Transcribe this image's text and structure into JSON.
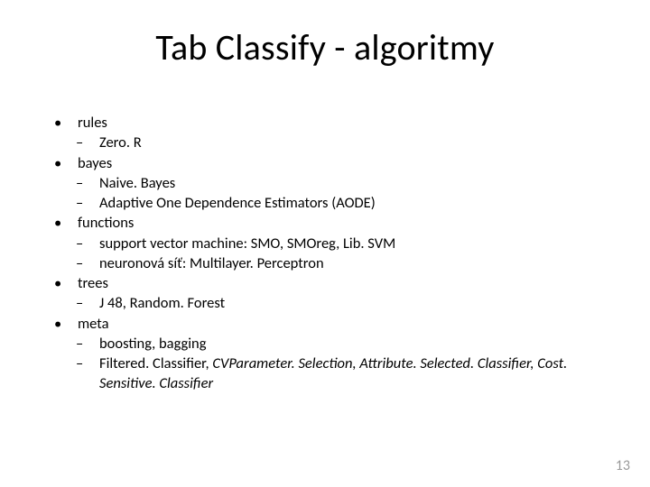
{
  "title": "Tab Classify - algoritmy",
  "bullet_char": "•",
  "dash_char": "–",
  "items": [
    {
      "label": "rules",
      "subs": [
        {
          "parts": [
            {
              "text": "Zero. R"
            }
          ]
        }
      ]
    },
    {
      "label": "bayes",
      "subs": [
        {
          "parts": [
            {
              "text": "Naive. Bayes"
            }
          ]
        },
        {
          "parts": [
            {
              "text": "Adaptive One Dependence Estimators (AODE)"
            }
          ]
        }
      ]
    },
    {
      "label": "functions",
      "subs": [
        {
          "parts": [
            {
              "text": "support vector machine: SMO, SMOreg, Lib. SVM"
            }
          ]
        },
        {
          "parts": [
            {
              "text": "neuronová síť: Multilayer. Perceptron"
            }
          ]
        }
      ]
    },
    {
      "label": "trees",
      "subs": [
        {
          "parts": [
            {
              "text": "J 48, Random. Forest"
            }
          ]
        }
      ]
    },
    {
      "label": "meta",
      "subs": [
        {
          "parts": [
            {
              "text": "boosting, bagging"
            }
          ]
        },
        {
          "parts": [
            {
              "text": "Filtered. Classifier, "
            },
            {
              "text": "CVParameter. Selection, Attribute. Selected. Classifier, Cost. Sensitive. Classifier",
              "italic": true
            }
          ]
        }
      ]
    }
  ],
  "page_number": "13"
}
